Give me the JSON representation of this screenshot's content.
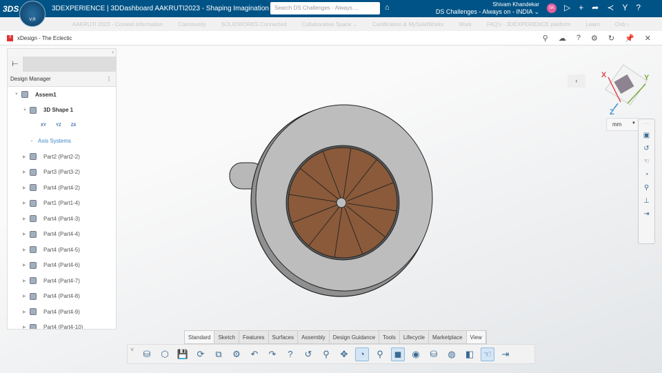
{
  "topbar": {
    "brand": "3DS",
    "compass_label": "V,R",
    "title": "3DEXPERIENCE | 3DDashboard AAKRUTI2023 - Shaping Imagination ⌄",
    "search_placeholder": "Search DS Challenges - Always ...",
    "user_name": "Shivam Khandekar",
    "tenant": "DS Challenges - Always on - INDIA ⌄",
    "avatar": "SK"
  },
  "nav": [
    "AAKRUTI 2023 - Contest information",
    "Community",
    "SOLIDWORKS Connected",
    "Collaborative Space ⌄",
    "Certification & MySolidWorks",
    "Work",
    "FAQ's - 3DEXPERIENCE platform",
    "Learn",
    "Onb ›"
  ],
  "window": {
    "title": "xDesign - The Eclectic"
  },
  "sidebar": {
    "header": "Design Manager",
    "tree": [
      {
        "label": "Assem1",
        "level": 0,
        "expanded": true
      },
      {
        "label": "3D Shape 1",
        "level": 1,
        "expanded": true
      },
      {
        "label": "Axis Systems",
        "level": 2,
        "link": true
      },
      {
        "label": "Part2 (Part2-2)",
        "level": 1
      },
      {
        "label": "Part3 (Part3-2)",
        "level": 1
      },
      {
        "label": "Part4 (Part4-2)",
        "level": 1
      },
      {
        "label": "Part1 (Part1-4)",
        "level": 1
      },
      {
        "label": "Part4 (Part4-3)",
        "level": 1
      },
      {
        "label": "Part4 (Part4-4)",
        "level": 1
      },
      {
        "label": "Part4 (Part4-5)",
        "level": 1
      },
      {
        "label": "Part4 (Part4-6)",
        "level": 1
      },
      {
        "label": "Part4 (Part4-7)",
        "level": 1
      },
      {
        "label": "Part4 (Part4-8)",
        "level": 1
      },
      {
        "label": "Part4 (Part4-9)",
        "level": 1
      },
      {
        "label": "Part4 (Part4-10)",
        "level": 1
      }
    ],
    "planes": [
      "XY",
      "YZ",
      "ZX"
    ]
  },
  "tabs": [
    "Standard",
    "Sketch",
    "Features",
    "Surfaces",
    "Assembly",
    "Design Guidance",
    "Tools",
    "Lifecycle",
    "Marketplace",
    "View"
  ],
  "active_tab": "Standard",
  "units": "mm",
  "axes": {
    "x": "X",
    "y": "Y",
    "z": "Z"
  },
  "colors": {
    "topbar": "#005386",
    "wood": "#8a5a3a"
  }
}
